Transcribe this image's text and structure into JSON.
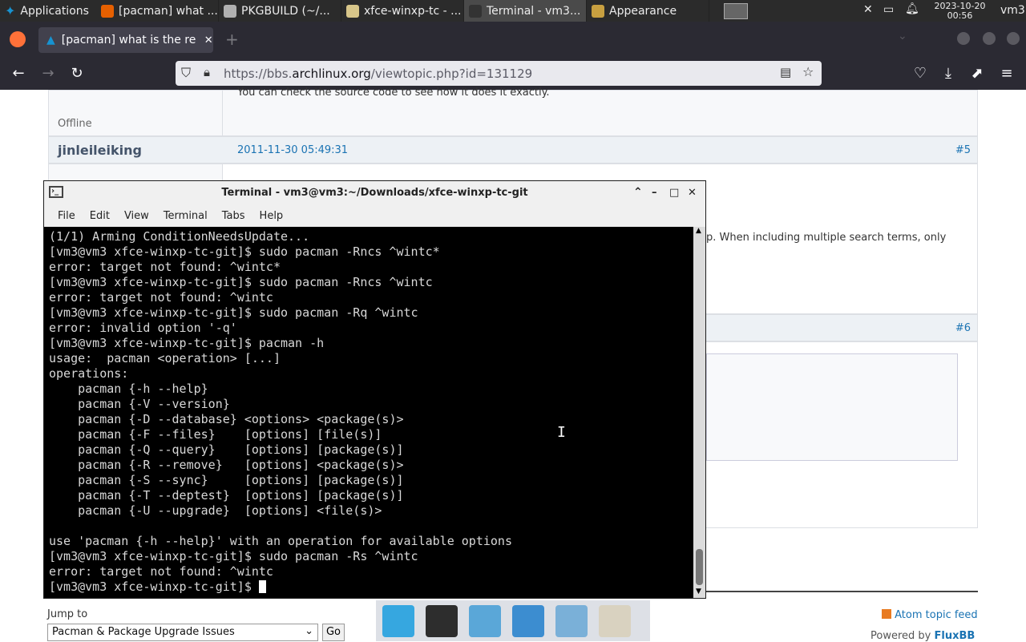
{
  "panel": {
    "apps_label": "Applications",
    "tasks": [
      {
        "label": "[pacman] what ...",
        "color": "#e66000"
      },
      {
        "label": "PKGBUILD (~/...",
        "color": "#b0b0b0"
      },
      {
        "label": "xfce-winxp-tc - ...",
        "color": "#d8c68a"
      },
      {
        "label": "Terminal - vm3...",
        "color": "#333333",
        "active": true
      },
      {
        "label": "Appearance",
        "color": "#c8a040"
      }
    ],
    "clock_date": "2023-10-20",
    "clock_time": "00:56",
    "user": "vm3"
  },
  "browser": {
    "tab_title": "[pacman] what is the re",
    "url_prefix": "https://bbs.",
    "url_domain": "archlinux.org",
    "url_path": "/viewtopic.php?id=131129"
  },
  "forum": {
    "prev_post_text": "You can check the source code to see how it does it exactly.",
    "offline_label": "Offline",
    "post5": {
      "author": "jinleileiking",
      "time": "2011-11-30 05:49:31",
      "number": "#5"
    },
    "post5_text_fragment": "p. When including multiple search terms, only",
    "post6_number": "#6",
    "jump_label": "Jump to",
    "jump_select": "Pacman & Package Upgrade Issues",
    "go_label": "Go",
    "atom_label": "Atom topic feed",
    "powered_by": "Powered by",
    "fluxbb": "FluxBB"
  },
  "terminal": {
    "title": "Terminal - vm3@vm3:~/Downloads/xfce-winxp-tc-git",
    "menus": [
      "File",
      "Edit",
      "View",
      "Terminal",
      "Tabs",
      "Help"
    ],
    "lines": [
      "(1/1) Arming ConditionNeedsUpdate...",
      "[vm3@vm3 xfce-winxp-tc-git]$ sudo pacman -Rncs ^wintc*",
      "error: target not found: ^wintc*",
      "[vm3@vm3 xfce-winxp-tc-git]$ sudo pacman -Rncs ^wintc",
      "error: target not found: ^wintc",
      "[vm3@vm3 xfce-winxp-tc-git]$ sudo pacman -Rq ^wintc",
      "error: invalid option '-q'",
      "[vm3@vm3 xfce-winxp-tc-git]$ pacman -h",
      "usage:  pacman <operation> [...]",
      "operations:",
      "    pacman {-h --help}",
      "    pacman {-V --version}",
      "    pacman {-D --database} <options> <package(s)>",
      "    pacman {-F --files}    [options] [file(s)]",
      "    pacman {-Q --query}    [options] [package(s)]",
      "    pacman {-R --remove}   [options] <package(s)>",
      "    pacman {-S --sync}     [options] [package(s)]",
      "    pacman {-T --deptest}  [options] [package(s)]",
      "    pacman {-U --upgrade}  [options] <file(s)>",
      "",
      "use 'pacman {-h --help}' with an operation for available options",
      "[vm3@vm3 xfce-winxp-tc-git]$ sudo pacman -Rs ^wintc",
      "error: target not found: ^wintc",
      "[vm3@vm3 xfce-winxp-tc-git]$ "
    ]
  },
  "dock": [
    {
      "name": "desktop-icon",
      "color": "#36a7e0"
    },
    {
      "name": "terminal-icon",
      "color": "#2d2d2d"
    },
    {
      "name": "file-manager-icon",
      "color": "#5aa7d8"
    },
    {
      "name": "web-browser-icon",
      "color": "#3c8dd0"
    },
    {
      "name": "app-finder-icon",
      "color": "#7ab0d8"
    },
    {
      "name": "folder-icon",
      "color": "#d9d2c0"
    }
  ]
}
